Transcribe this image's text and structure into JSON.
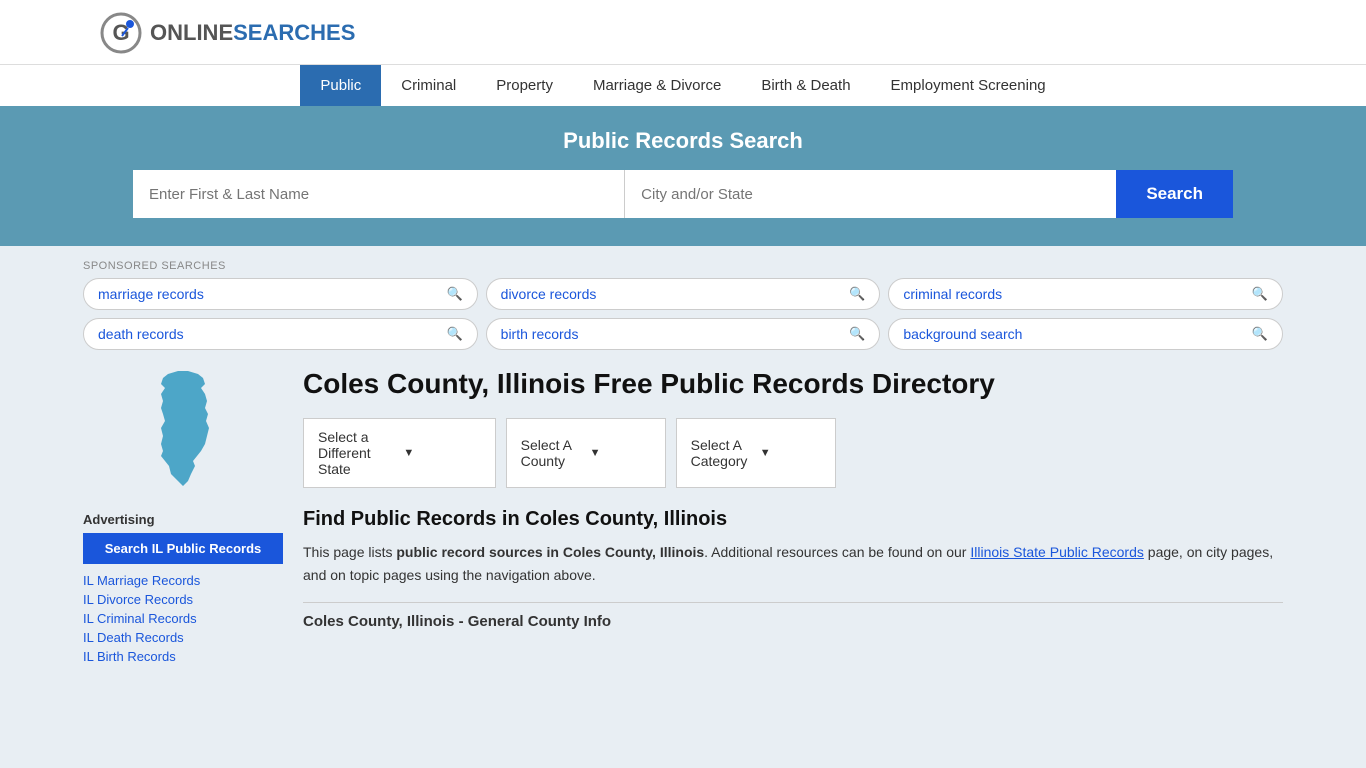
{
  "header": {
    "logo_online": "ONLINE",
    "logo_searches": "SEARCHES"
  },
  "nav": {
    "items": [
      {
        "label": "Public",
        "active": true
      },
      {
        "label": "Criminal",
        "active": false
      },
      {
        "label": "Property",
        "active": false
      },
      {
        "label": "Marriage & Divorce",
        "active": false
      },
      {
        "label": "Birth & Death",
        "active": false
      },
      {
        "label": "Employment Screening",
        "active": false
      }
    ]
  },
  "search_hero": {
    "title": "Public Records Search",
    "name_placeholder": "Enter First & Last Name",
    "location_placeholder": "City and/or State",
    "button_label": "Search"
  },
  "sponsored": {
    "label": "SPONSORED SEARCHES",
    "items": [
      "marriage records",
      "divorce records",
      "criminal records",
      "death records",
      "birth records",
      "background search"
    ]
  },
  "sidebar": {
    "advertising_label": "Advertising",
    "ad_button_label": "Search IL Public Records",
    "links": [
      "IL Marriage Records",
      "IL Divorce Records",
      "IL Criminal Records",
      "IL Death Records",
      "IL Birth Records"
    ]
  },
  "main": {
    "page_title": "Coles County, Illinois Free Public Records Directory",
    "dropdowns": {
      "state_label": "Select a Different State",
      "county_label": "Select A County",
      "category_label": "Select A Category"
    },
    "find_heading": "Find Public Records in Coles County, Illinois",
    "description_part1": "This page lists ",
    "description_bold": "public record sources in Coles County, Illinois",
    "description_part2": ". Additional resources can be found on our ",
    "description_link_text": "Illinois State Public Records",
    "description_part3": " page, on city pages, and on topic pages using the navigation above.",
    "general_info_label": "Coles County, Illinois - General County Info"
  }
}
